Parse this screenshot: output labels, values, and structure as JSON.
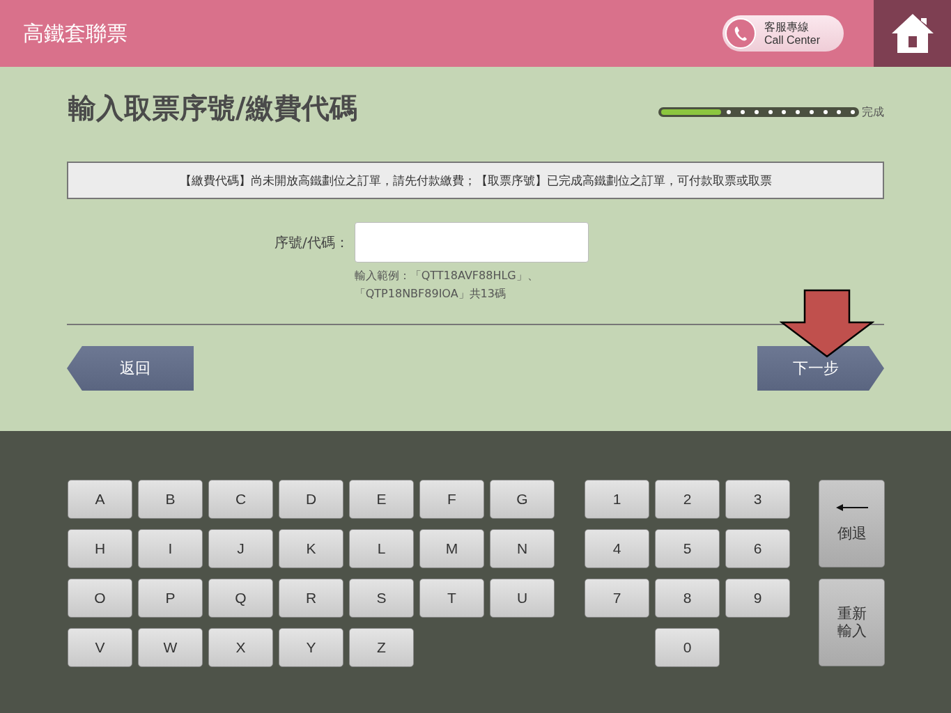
{
  "header": {
    "title": "高鐵套聯票",
    "call_center": {
      "label_zh": "客服專線",
      "label_en": "Call Center"
    }
  },
  "page_title": "輸入取票序號/繳費代碼",
  "progress": {
    "level": 0.3,
    "label": "完成"
  },
  "notice": "【繳費代碼】尚未開放高鐵劃位之訂單，請先付款繳費；【取票序號】已完成高鐵劃位之訂單，可付款取票或取票",
  "form": {
    "label": "序號/代碼：",
    "hint_lines": [
      "輸入範例：「QTT18AVF88HLG」、",
      "「QTP18NBF89IOA」共13碼"
    ]
  },
  "nav": {
    "back": "返回",
    "next": "下一步"
  },
  "keyboard": {
    "letters": [
      "A",
      "B",
      "C",
      "D",
      "E",
      "F",
      "G",
      "H",
      "I",
      "J",
      "K",
      "L",
      "M",
      "N",
      "O",
      "P",
      "Q",
      "R",
      "S",
      "T",
      "U",
      "V",
      "W",
      "X",
      "Y",
      "Z"
    ],
    "digits": [
      "1",
      "2",
      "3",
      "4",
      "5",
      "6",
      "7",
      "8",
      "9",
      "0"
    ],
    "backspace": "倒退",
    "reset": "重新輸入"
  }
}
